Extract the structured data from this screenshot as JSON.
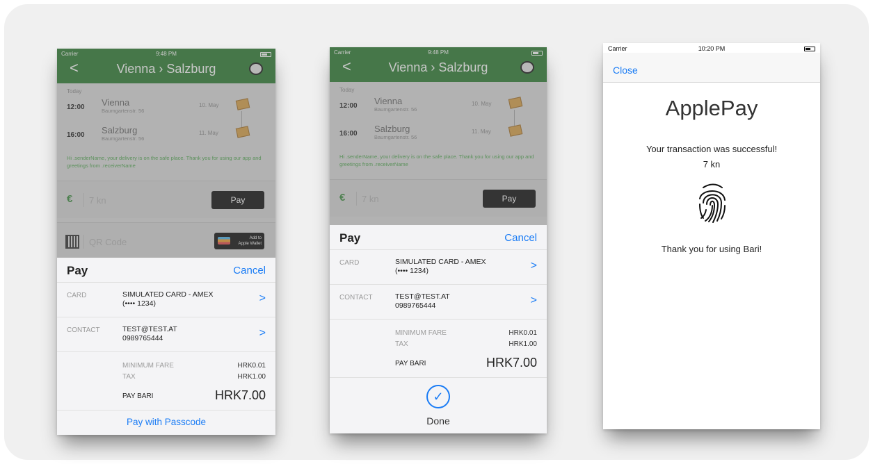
{
  "colors": {
    "accent": "#1a7cf5",
    "brand_green": "#2e7d32",
    "message_green": "#4fa64f"
  },
  "app": {
    "status_carrier": "Carrier",
    "status_time": "9:48 PM",
    "back_glyph": "<",
    "title": "Vienna › Salzburg",
    "today": "Today",
    "legs": [
      {
        "time": "12:00",
        "city": "Vienna",
        "address": "Baumgartenstr. 56",
        "date": "10. May"
      },
      {
        "time": "16:00",
        "city": "Salzburg",
        "address": "Baumgartenstr. 56",
        "date": "11. May"
      }
    ],
    "message": "Hi .senderName, your delivery is on the safe place. Thank you for using our app and greetings from .receiverName",
    "currency_symbol": "€",
    "amount": "7 kn",
    "pay_button": " Pay",
    "qr_label": "QR Code",
    "wallet_line1": "Add to",
    "wallet_line2": "Apple Wallet"
  },
  "sheet": {
    "logo": " Pay",
    "cancel": "Cancel",
    "card_label": "CARD",
    "card_line1": "SIMULATED CARD - AMEX",
    "card_line2": "(•••• 1234)",
    "contact_label": "CONTACT",
    "contact_line1": "TEST@TEST.AT",
    "contact_line2": "0989765444",
    "minimum_fare_label": "MINIMUM FARE",
    "minimum_fare_value": "HRK0.01",
    "tax_label": "TAX",
    "tax_value": "HRK1.00",
    "pay_label": "PAY BARI",
    "pay_value": "HRK7.00",
    "pay_with_passcode": "Pay with Passcode",
    "done": "Done",
    "chevron": ">"
  },
  "result": {
    "status_carrier": "Carrier",
    "status_time": "10:20 PM",
    "close": "Close",
    "title": "ApplePay",
    "message": "Your transaction was successful!",
    "amount": "7 kn",
    "thanks": "Thank you for using Bari!"
  }
}
